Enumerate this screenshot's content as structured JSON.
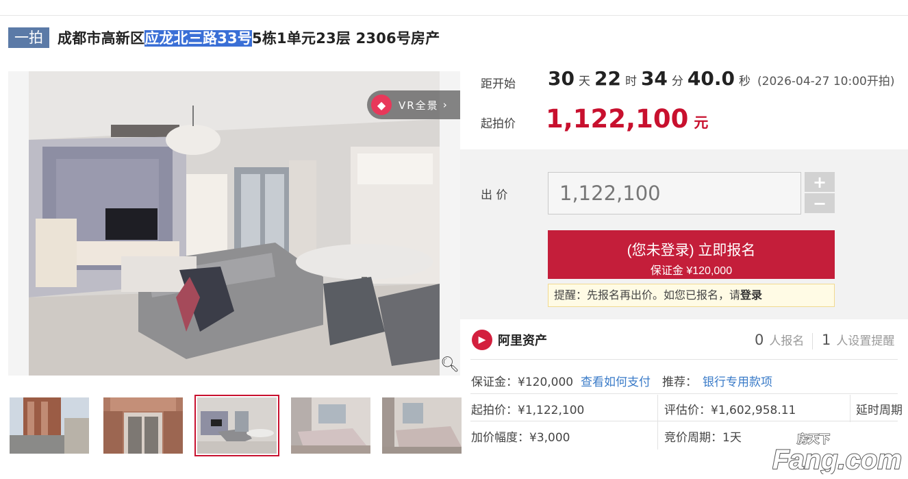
{
  "title": {
    "badge": "一拍",
    "prefix": "成都市高新区",
    "highlight": "应龙北三路33号",
    "suffix": "5栋1单元23层 2306号房产"
  },
  "gallery": {
    "vr_label": "VR全景",
    "vr_chevron": "›",
    "zoom_icon": "magnifier-icon",
    "thumbnails": [
      "exterior-tower",
      "building-entrance",
      "living-room",
      "bedroom-1",
      "bedroom-2"
    ],
    "active_thumbnail": 2
  },
  "countdown": {
    "label": "距开始",
    "days": "30",
    "days_unit": "天",
    "hours": "22",
    "hours_unit": "时",
    "minutes": "34",
    "minutes_unit": "分",
    "seconds": "40.0",
    "seconds_unit": "秒",
    "start_text": "(2026-04-27 10:00开拍)"
  },
  "start_price": {
    "label": "起拍价",
    "value": "1,122,100",
    "unit": "元"
  },
  "bid": {
    "label": "出 价",
    "input_value": "1,122,100",
    "plus": "+",
    "minus": "−"
  },
  "signup": {
    "main": "(您未登录) 立即报名",
    "deposit": "保证金 ¥120,000"
  },
  "reminder": {
    "text": "提醒：先报名再出价。如您已报名，请",
    "login": "登录"
  },
  "platform": {
    "name": "阿里资产",
    "icon": "ali-assets-icon"
  },
  "stats": {
    "signups_count": "0",
    "signups_label": "人报名",
    "reminders_count": "1",
    "reminders_label": "人设置提醒"
  },
  "info": {
    "deposit": "保证金：¥120,000",
    "how_to_pay": "查看如何支付",
    "recommend_label": "推荐：",
    "recommend_link": "银行专用款项",
    "start_price": "起拍价：¥1,122,100",
    "appraisal": "评估价：¥1,602,958.11",
    "extension": "延时周期",
    "increment": "加价幅度：¥3,000",
    "bid_period": "竞价周期：1天"
  },
  "watermark": {
    "line1": "房天下",
    "line2": "Fang.com"
  },
  "colors": {
    "accent_red": "#c41e3a",
    "price_red": "#c8102e",
    "badge_blue": "#5b7aa7",
    "link_blue": "#3a7bc8",
    "highlight_blue": "#3a6fd6"
  }
}
